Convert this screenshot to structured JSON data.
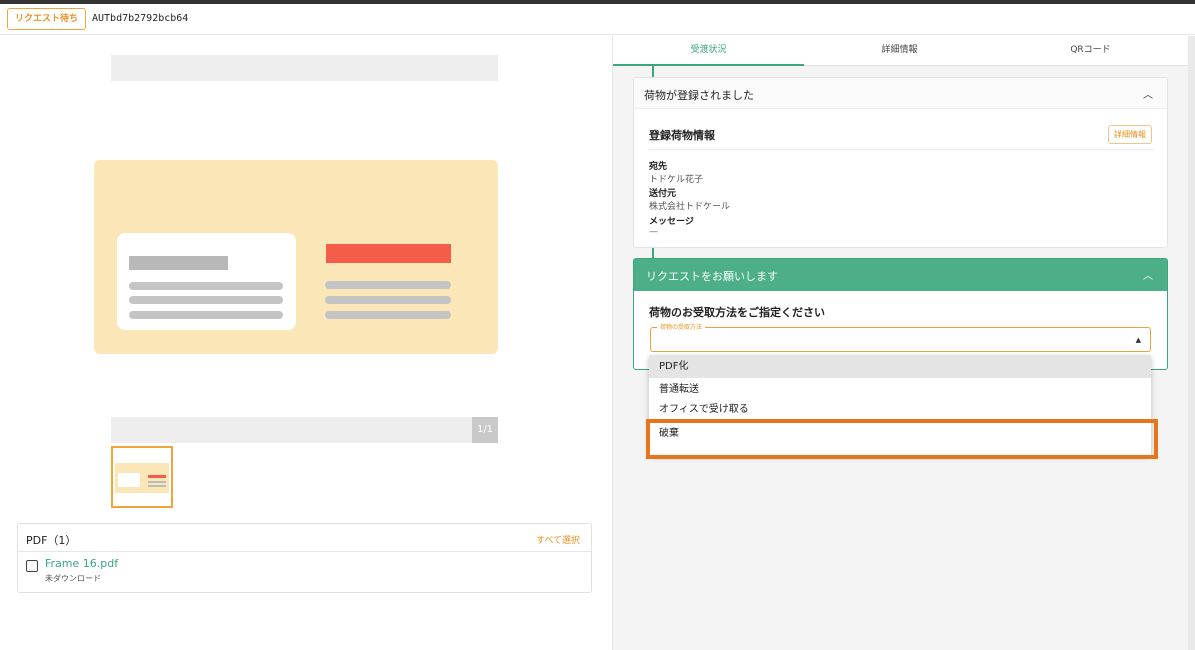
{
  "header": {
    "status_badge": "リクエスト待ち",
    "document_id": "AUTbd7b2792bcb64"
  },
  "preview": {
    "page_counter": "1/1"
  },
  "pdf_list": {
    "title": "PDF（1）",
    "select_all": "すべて選択",
    "files": [
      {
        "name": "Frame 16.pdf",
        "status": "未ダウンロード"
      }
    ]
  },
  "tabs": [
    {
      "label": "受渡状況",
      "active": true
    },
    {
      "label": "詳細情報",
      "active": false
    },
    {
      "label": "QRコード",
      "active": false
    }
  ],
  "registered_card": {
    "title": "荷物が登録されました",
    "section_title": "登録荷物情報",
    "detail_button": "詳細情報",
    "fields": [
      {
        "label": "宛先",
        "value": "トドケル花子"
      },
      {
        "label": "送付元",
        "value": "株式会社トドケール"
      },
      {
        "label": "メッセージ",
        "value": "—"
      }
    ]
  },
  "request_card": {
    "title": "リクエストをお願いします",
    "question": "荷物のお受取方法をご指定ください",
    "select_label": "荷物の受取方法",
    "options": [
      "PDF化",
      "普通転送",
      "オフィスで受け取る",
      "破棄"
    ],
    "highlighted_option": "破棄"
  },
  "colors": {
    "accent_green": "#3aa67a",
    "header_green": "#4caf87",
    "accent_orange": "#e8921f",
    "highlight_orange": "#e8741c"
  },
  "icons": {
    "collapse": "chevron-up-icon",
    "select_arrow": "caret-up-icon"
  }
}
